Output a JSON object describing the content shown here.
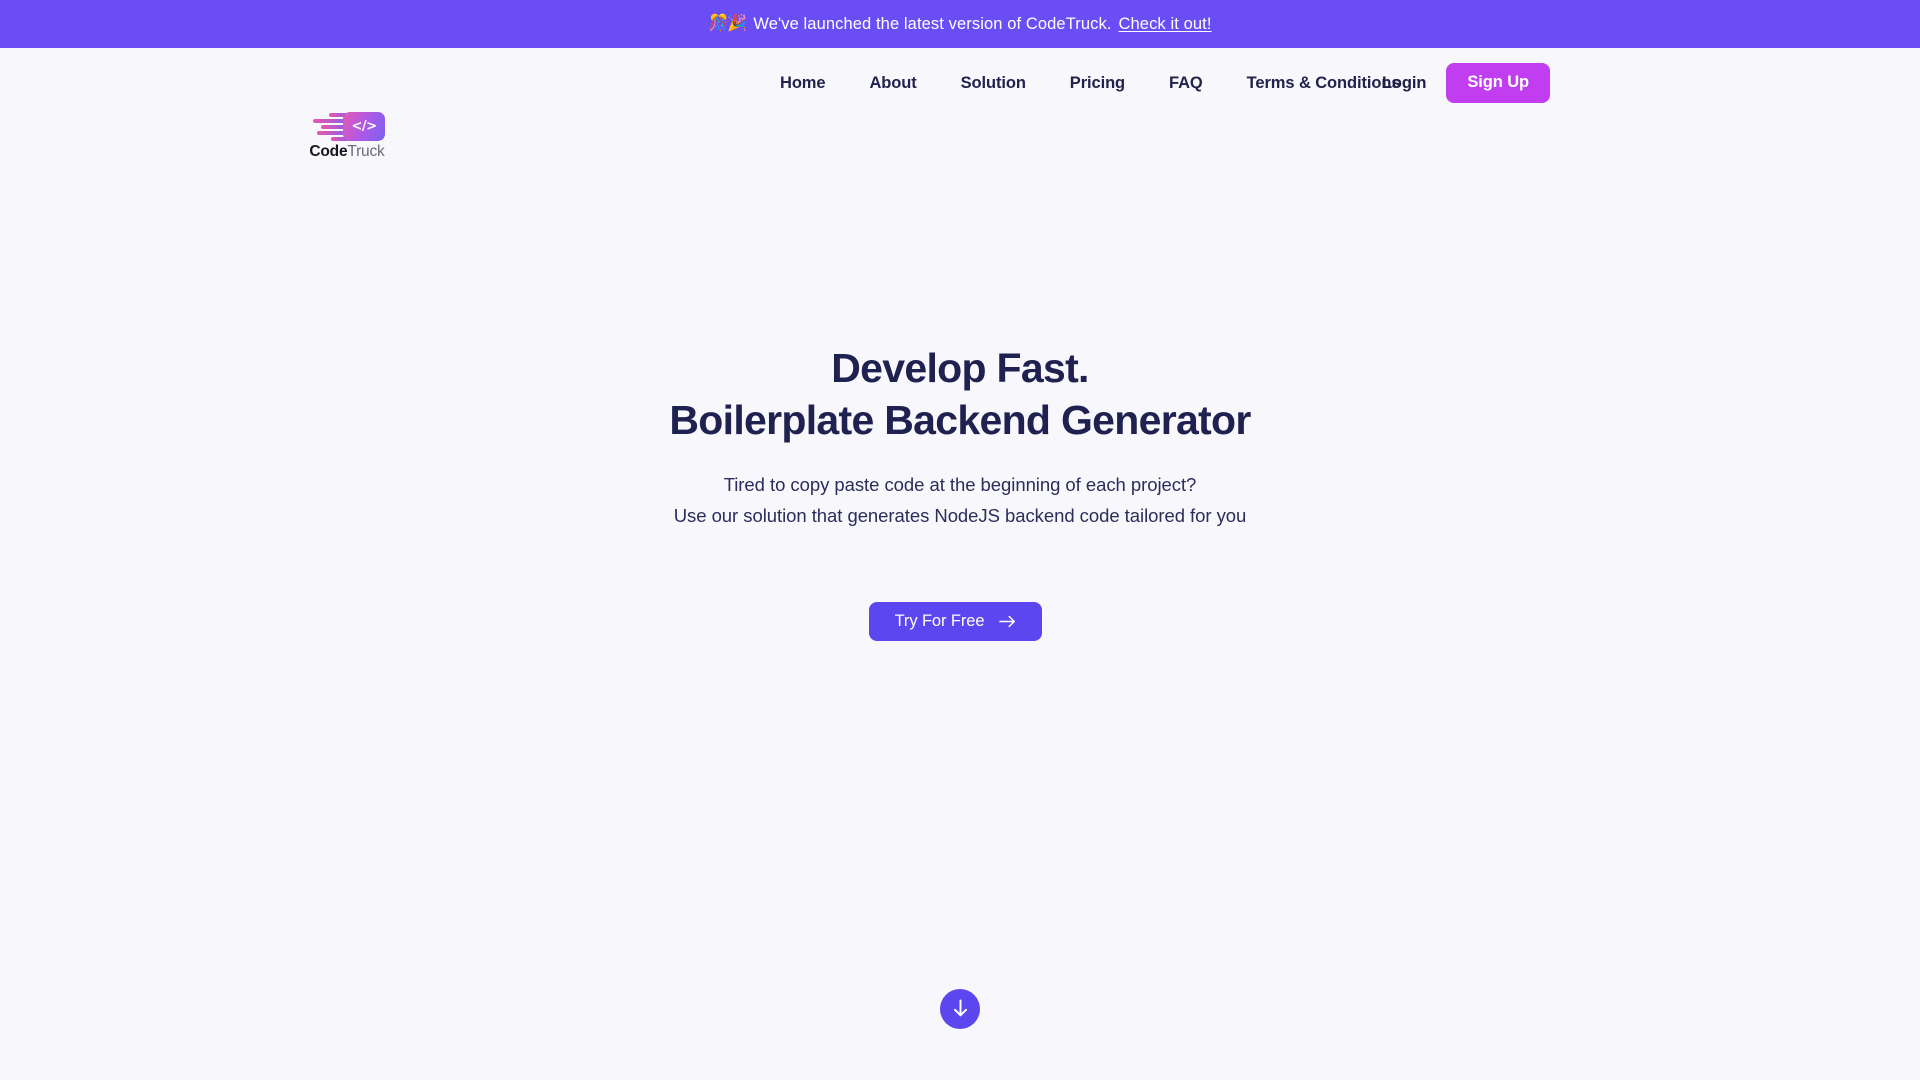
{
  "announcement": {
    "emoji": "🎊🎉",
    "emoji_name": "party-popper-confetti",
    "text": "We've launched the latest version of CodeTruck.",
    "link_label": "Check it out!",
    "background_color": "#6a4df5",
    "text_color": "#ffffff"
  },
  "header": {
    "logo": {
      "code_word": "Code",
      "truck_word": "Truck",
      "badge_glyph": "</>",
      "gradient_from": "#e35bb4",
      "gradient_to": "#7b62ee"
    },
    "nav": [
      {
        "label": "Home"
      },
      {
        "label": "About"
      },
      {
        "label": "Solution"
      },
      {
        "label": "Pricing"
      },
      {
        "label": "FAQ"
      },
      {
        "label": "Terms & Conditions"
      }
    ],
    "login_label": "Login",
    "signup_label": "Sign Up",
    "signup_color": "#c13ef0"
  },
  "hero": {
    "title_line1": "Develop Fast.",
    "title_line2": "Boilerplate Backend Generator",
    "title_color": "#1f2150",
    "subtitle_line1": "Tired to copy paste code at the beginning of each project?",
    "subtitle_line2": "Use our solution that generates NodeJS backend code tailored for you",
    "cta_label": "Try For Free",
    "cta_color": "#5b46f0",
    "scroll_hint": "Scroll down"
  },
  "page": {
    "background_color": "#f8f7fb"
  }
}
